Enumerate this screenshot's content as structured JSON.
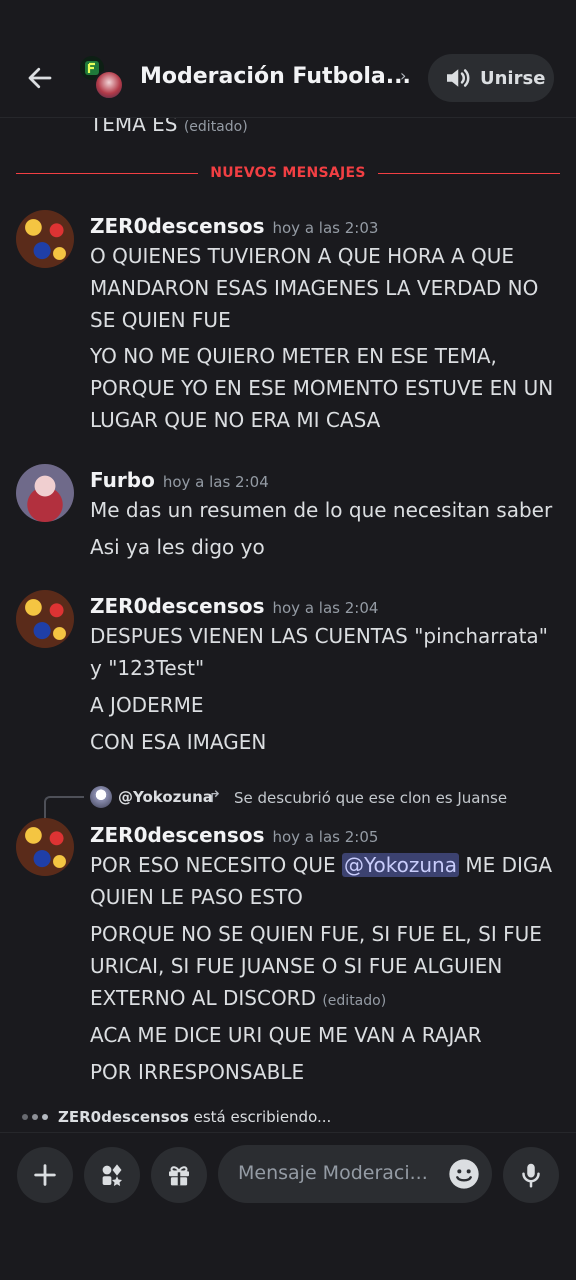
{
  "header": {
    "title": "Moderación Futbola...",
    "chevron": "›",
    "join_label": "Unirse"
  },
  "feed": {
    "cut_text": "TEMA ES",
    "cut_edited": "(editado)",
    "divider_label": "NUEVOS MENSAJES"
  },
  "messages": [
    {
      "author": "ZER0descensos",
      "time": "hoy a las 2:03",
      "lines": [
        "O QUIENES TUVIERON A QUE HORA A QUE MANDARON ESAS IMAGENES LA VERDAD NO SE QUIEN FUE",
        "YO NO ME QUIERO METER EN ESE TEMA, PORQUE YO EN ESE MOMENTO ESTUVE EN UN LUGAR QUE NO ERA MI CASA"
      ]
    },
    {
      "author": "Furbo",
      "time": "hoy a las 2:04",
      "lines": [
        "Me das un resumen de lo que necesitan saber",
        "Asi ya les digo yo"
      ]
    },
    {
      "author": "ZER0descensos",
      "time": "hoy a las 2:04",
      "lines": [
        "DESPUES VIENEN LAS CUENTAS \"pincharrata\" y \"123Test\"",
        "A JODERME",
        "CON ESA IMAGEN"
      ]
    },
    {
      "reply": {
        "name": "@Yokozuna",
        "text": "Se descubrió que ese clon es Juanse"
      },
      "author": "ZER0descensos",
      "time": "hoy a las 2:05",
      "line1_pre": "POR ESO NECESITO QUE ",
      "mention": "@Yokozuna",
      "line1_post": " ME DIGA QUIEN LE PASO ESTO",
      "line2": "PORQUE NO SE QUIEN FUE, SI FUE EL, SI FUE URICAI, SI FUE JUANSE O SI FUE ALGUIEN EXTERNO AL DISCORD",
      "line2_edited": "(editado)",
      "line3": "ACA ME DICE URI QUE ME VAN A RAJAR",
      "line4": "POR IRRESPONSABLE"
    }
  ],
  "typing": {
    "user": "ZER0descensos",
    "suffix": " está escribiendo..."
  },
  "composer": {
    "placeholder": "Mensaje Moderaci..."
  },
  "icons": {
    "back": "arrow-left-icon",
    "join": "speaker-icon",
    "add": "plus-icon",
    "apps": "apps-icon",
    "gift": "gift-icon",
    "emoji": "emoji-icon",
    "mic": "microphone-icon"
  },
  "colors": {
    "background": "#1a1a1e",
    "new_messages": "#f23f43",
    "mention_bg": "#3c4270"
  }
}
